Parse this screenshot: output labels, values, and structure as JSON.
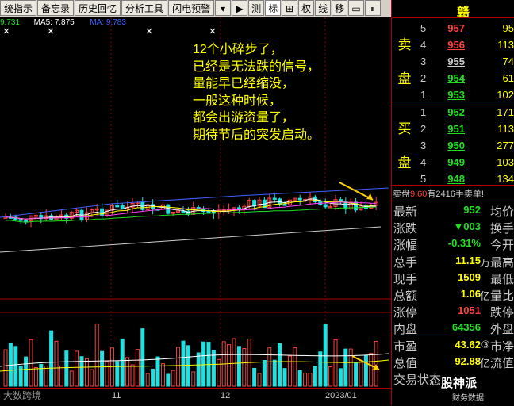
{
  "toolbar": {
    "items": [
      "统指示",
      "备忘录",
      "历史回忆",
      "分析工具",
      "闪电预警",
      "▾",
      "▶",
      "测",
      "标",
      "⊞",
      "权",
      "线",
      "移",
      "▭",
      "⏸"
    ],
    "active_index": 8
  },
  "indicators": {
    "ma_prev": "9.731",
    "ma5": "MA5: 7.875",
    "ma_next": "MA: 9.783"
  },
  "annotation": {
    "lines": [
      "12个小碎步了，",
      "已经是无法跌的信号，",
      "量能早已经缩没，",
      "一般这种时候，",
      "都会出游资量了，",
      "期待节后的突发启动。"
    ]
  },
  "dates": [
    "11",
    "12",
    "2023/01"
  ],
  "quote": {
    "stock_name": "赣",
    "sell_label": [
      "卖",
      "盘"
    ],
    "buy_label": [
      "买",
      "盘"
    ],
    "asks": [
      {
        "level": "5",
        "price": "957",
        "vol": "95",
        "color": "#ff4040"
      },
      {
        "level": "4",
        "price": "956",
        "vol": "113",
        "color": "#ff4040"
      },
      {
        "level": "3",
        "price": "955",
        "vol": "74",
        "color": "#cccccc"
      },
      {
        "level": "2",
        "price": "954",
        "vol": "61",
        "color": "#20e020"
      },
      {
        "level": "1",
        "price": "953",
        "vol": "102",
        "color": "#20e020"
      }
    ],
    "bids": [
      {
        "level": "1",
        "price": "952",
        "vol": "171",
        "color": "#20e020"
      },
      {
        "level": "2",
        "price": "951",
        "vol": "113",
        "color": "#20e020"
      },
      {
        "level": "3",
        "price": "950",
        "vol": "277",
        "color": "#20e020"
      },
      {
        "level": "4",
        "price": "949",
        "vol": "103",
        "color": "#20e020"
      },
      {
        "level": "5",
        "price": "948",
        "vol": "134",
        "color": "#20e020"
      }
    ],
    "message_prefix": "卖盘",
    "message_value": "9.60",
    "message_suffix": "有2416手卖单!",
    "stats": [
      {
        "label": "最新",
        "value": "952",
        "color": "#20e020",
        "unit": "",
        "label2": "均价"
      },
      {
        "label": "涨跌",
        "value": "▼003",
        "color": "#20e020",
        "unit": "",
        "label2": "换手"
      },
      {
        "label": "涨幅",
        "value": "-0.31%",
        "color": "#20e020",
        "unit": "",
        "label2": "今开"
      },
      {
        "label": "总手",
        "value": "11.15",
        "color": "#ffff00",
        "unit": "万",
        "label2": "最高"
      },
      {
        "label": "现手",
        "value": "1509",
        "color": "#ffff00",
        "unit": "",
        "label2": "最低"
      },
      {
        "label": "总额",
        "value": "1.06",
        "color": "#ffff00",
        "unit": "亿",
        "label2": "量比"
      },
      {
        "label": "涨停",
        "value": "1051",
        "color": "#ff4040",
        "unit": "",
        "label2": "跌停"
      },
      {
        "label": "内盘",
        "value": "64356",
        "color": "#20e020",
        "unit": "",
        "label2": "外盘"
      },
      {
        "label": "市盈",
        "value": "43.62",
        "color": "#ffff00",
        "unit": "③",
        "label2": "市净"
      },
      {
        "label": "总值",
        "value": "92.88",
        "color": "#ffff00",
        "unit": "亿",
        "label2": "流值"
      },
      {
        "label": "交易状态",
        "value": "",
        "color": "#ffff00",
        "unit": "",
        "label2": ""
      }
    ]
  },
  "watermark_left": "大数跨境",
  "watermark_right": {
    "title": "股神派",
    "subtitle": "财务数据"
  },
  "colors": {
    "up": "#ff4040",
    "down": "#20e0e0",
    "ma5": "#ffffff",
    "ma10": "#ffff00",
    "ma20": "#ff40ff",
    "ma60": "#20e020",
    "ma120": "#4060ff",
    "ma250": "#cccccc",
    "arrow": "#ffd000"
  }
}
